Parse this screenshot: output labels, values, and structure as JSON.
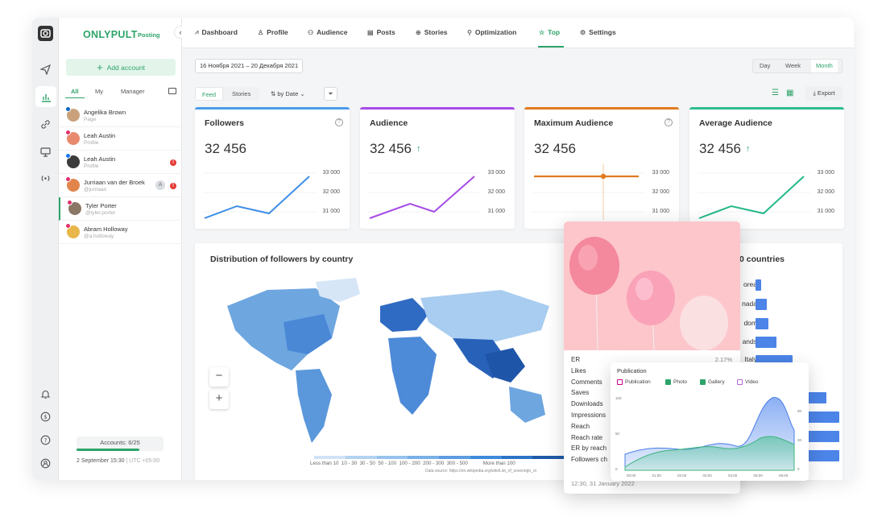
{
  "brand": {
    "name": "ONLYPULT",
    "sub": "Posting"
  },
  "sidebar": {
    "add_account": "Add account",
    "tabs": [
      "All",
      "My",
      "Manager"
    ],
    "accounts": [
      {
        "name": "Angelika Brown",
        "sub": "Page",
        "network": "linkedin"
      },
      {
        "name": "Leah Austin",
        "sub": "Profile",
        "network": "instagram"
      },
      {
        "name": "Leah Austin",
        "sub": "Profile",
        "network": "facebook",
        "warn": "!"
      },
      {
        "name": "Jurriaan van der Broek",
        "sub": "@jurriaan",
        "network": "instagram",
        "mini": "A",
        "warn": "!"
      },
      {
        "name": "Tyler Porter",
        "sub": "@tyler.porter",
        "network": "instagram",
        "selected": true
      },
      {
        "name": "Abram Holloway",
        "sub": "@a.holloway",
        "network": "instagram"
      }
    ],
    "accounts_count": "Accounts: 6/25",
    "date": "2 September 15:30",
    "tz": "UTC +05:00"
  },
  "nav": {
    "items": [
      {
        "label": "Dashboard",
        "icon": "chart-icon"
      },
      {
        "label": "Profile",
        "icon": "user-icon"
      },
      {
        "label": "Audience",
        "icon": "users-icon"
      },
      {
        "label": "Posts",
        "icon": "posts-icon"
      },
      {
        "label": "Stories",
        "icon": "stories-icon"
      },
      {
        "label": "Optimization",
        "icon": "optimization-icon"
      },
      {
        "label": "Top",
        "icon": "star-icon",
        "active": true
      },
      {
        "label": "Settings",
        "icon": "gear-icon"
      }
    ]
  },
  "toolbar": {
    "date_range": "16 Ноября 2021 – 20 Декабря 2021",
    "periods": [
      "Day",
      "Week",
      "Month"
    ],
    "active_period": "Month",
    "segments": [
      "Feed",
      "Stories"
    ],
    "sort": "by Date",
    "export": "Export"
  },
  "cards": [
    {
      "title": "Followers",
      "value": "32 456",
      "color": "#4c9ce8",
      "up": false,
      "help": true,
      "y_labels": [
        "33 000",
        "32 000",
        "31 000"
      ],
      "line_color": "#3d8ee6",
      "points": [
        [
          0,
          0
        ],
        [
          40,
          15
        ],
        [
          80,
          6
        ],
        [
          130,
          52
        ]
      ]
    },
    {
      "title": "Audience",
      "value": "32 456",
      "color": "#a64be6",
      "up": true,
      "help": false,
      "y_labels": [
        "33 000",
        "32 000",
        "31 000"
      ],
      "line_color": "#a64be6",
      "points": [
        [
          0,
          0
        ],
        [
          50,
          18
        ],
        [
          80,
          8
        ],
        [
          130,
          52
        ]
      ]
    },
    {
      "title": "Maximum Audience",
      "value": "32 456",
      "color": "#e07b20",
      "up": false,
      "help": true,
      "y_labels": [
        "33 000",
        "32 000",
        "31 000"
      ],
      "line_color": "#e07b20",
      "points": [
        [
          0,
          52
        ],
        [
          130,
          52
        ]
      ]
    },
    {
      "title": "Average Audience",
      "value": "32 456",
      "color": "#2dbd8f",
      "up": true,
      "help": false,
      "y_labels": [
        "33 000",
        "32 000",
        "31 000"
      ],
      "line_color": "#23b88a",
      "points": [
        [
          0,
          0
        ],
        [
          40,
          15
        ],
        [
          80,
          6
        ],
        [
          130,
          52
        ]
      ]
    }
  ],
  "map": {
    "title": "Distribution of followers by country",
    "legend": [
      "Less than 10",
      "10 - 30",
      "30 - 50",
      "50 - 100",
      "100 - 200",
      "200 - 300",
      "300 - 500",
      "More than 100"
    ],
    "source": "Data source: https://en.wikipedia.org/wiki/List_of_sovereign_st",
    "zoom_out": "−",
    "zoom_in": "+"
  },
  "countries": {
    "title_tail": "0 countries",
    "labels": [
      "orea",
      "nada",
      "dom",
      "ands",
      "Italy"
    ]
  },
  "post_stats": {
    "rows": [
      {
        "label": "ER",
        "value": "2.17%"
      },
      {
        "label": "Likes",
        "value": ""
      },
      {
        "label": "Comments",
        "value": ""
      },
      {
        "label": "Saves",
        "value": ""
      },
      {
        "label": "Downloads",
        "value": ""
      },
      {
        "label": "Impressions",
        "value": ""
      },
      {
        "label": "Reach",
        "value": ""
      },
      {
        "label": "Reach rate",
        "value": ""
      },
      {
        "label": "ER by reach",
        "value": ""
      },
      {
        "label": "Followers ch",
        "value": ""
      }
    ],
    "time": "12:30, 31 January 2022"
  },
  "publication": {
    "title": "Publication",
    "legend": [
      {
        "label": "Publication",
        "checked": false,
        "color": "#c0408a"
      },
      {
        "label": "Photo",
        "checked": true,
        "color": "#2ea36a"
      },
      {
        "label": "Gallery",
        "checked": true,
        "color": "#2ea36a"
      },
      {
        "label": "Video",
        "checked": false,
        "color": "#b66ad6"
      }
    ],
    "x_ticks": [
      "00:00",
      "01:00",
      "02:00",
      "03:00",
      "04:00",
      "05:00",
      "06:00"
    ],
    "y_left": [
      "100",
      "50",
      "0"
    ],
    "y_right": [
      "90",
      "30",
      "0"
    ]
  }
}
